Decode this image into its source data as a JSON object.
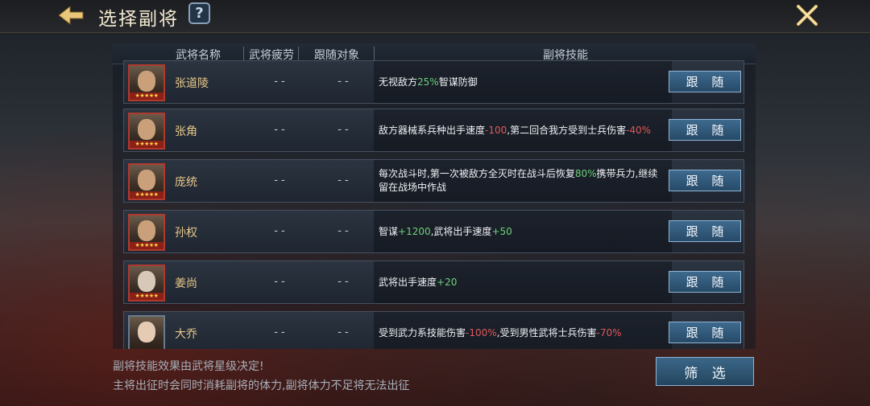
{
  "header": {
    "title": "选择副将",
    "help_label": "?"
  },
  "table": {
    "columns": [
      "武将名称",
      "武将疲劳",
      "跟随对象",
      "副将技能"
    ],
    "follow_label": "跟 随",
    "rows": [
      {
        "name": "张道陵",
        "stars": "★★★★★",
        "fatigue": "- -",
        "target": "- -",
        "skill": [
          {
            "t": "无视敌方"
          },
          {
            "t": "25%",
            "c": "g"
          },
          {
            "t": "智谋防御"
          }
        ]
      },
      {
        "name": "张角",
        "stars": "★★★★★",
        "fatigue": "- -",
        "target": "- -",
        "skill": [
          {
            "t": "敌方器械系兵种出手速度"
          },
          {
            "t": "-100",
            "c": "r"
          },
          {
            "t": ",第二回合我方受到士兵伤害"
          },
          {
            "t": "-40%",
            "c": "r"
          }
        ]
      },
      {
        "name": "庞统",
        "stars": "★★★★★",
        "fatigue": "- -",
        "target": "- -",
        "skill": [
          {
            "t": "每次战斗时,第一次被敌方全灭时在战斗后恢复"
          },
          {
            "t": "80%",
            "c": "g"
          },
          {
            "t": "携带兵力,继续留在战场中作战"
          }
        ]
      },
      {
        "name": "孙权",
        "stars": "★★★★★",
        "fatigue": "- -",
        "target": "- -",
        "skill": [
          {
            "t": "智谋"
          },
          {
            "t": "+1200",
            "c": "g"
          },
          {
            "t": ",武将出手速度"
          },
          {
            "t": "+50",
            "c": "g"
          }
        ]
      },
      {
        "name": "姜尚",
        "stars": "★★★★★",
        "fatigue": "- -",
        "target": "- -",
        "skill": [
          {
            "t": "武将出手速度"
          },
          {
            "t": "+20",
            "c": "g"
          }
        ]
      },
      {
        "name": "大乔",
        "stars": "★★★★★",
        "fatigue": "- -",
        "target": "- -",
        "skill": [
          {
            "t": "受到武力系技能伤害"
          },
          {
            "t": "-100%",
            "c": "r"
          },
          {
            "t": ",受到男性武将士兵伤害"
          },
          {
            "t": "-70%",
            "c": "r"
          }
        ]
      }
    ]
  },
  "footer": {
    "note1": "副将技能效果由武将星级决定!",
    "note2": "主将出征时会同时消耗副将的体力,副将体力不足将无法出征",
    "filter_label": "筛 选"
  },
  "icons": {
    "back": "back-arrow-icon",
    "close": "close-x-icon"
  },
  "colors": {
    "accent_gold": "#e8c88a",
    "positive": "#6fd07a",
    "negative": "#e0595a",
    "button_blue": "#2f5676"
  }
}
